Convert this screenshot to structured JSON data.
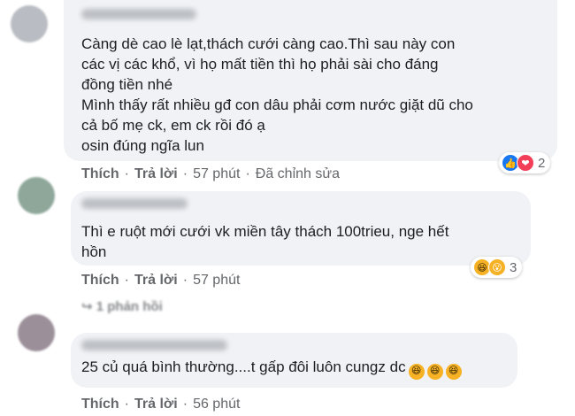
{
  "comments": [
    {
      "lines": [
        "Càng dè cao lè lạt,thách cưới càng cao.Thì sau này con",
        "các vị các khổ, vì họ mất tiền thì họ phải sài cho đáng",
        "đồng tiền nhé",
        "Mình thấy rất nhiều gđ con dâu phải cơm nước giặt dũ cho",
        "cả bố mẹ ck, em ck rồi đó ạ",
        "osin đúng ngĩa lun"
      ],
      "like": "Thích",
      "reply": "Trả lời",
      "time": "57 phút",
      "edited": "Đã chỉnh sửa",
      "reaction_icons": [
        "like-icon",
        "love-icon"
      ],
      "reaction_count": "2"
    },
    {
      "lines": [
        "Thì e ruột mới cưới vk miền tây thách 100trieu, nge hết",
        "hồn"
      ],
      "like": "Thích",
      "reply": "Trả lời",
      "time": "57 phút",
      "reaction_icons": [
        "haha-icon",
        "wow-icon"
      ],
      "reaction_count": "3",
      "replies_label": "1 phản hồi"
    },
    {
      "text": "25 củ quá bình thường....t gấp đôi luôn cungz dc",
      "inline_emoji": [
        "haha-icon",
        "haha-icon",
        "haha-icon"
      ],
      "like": "Thích",
      "reply": "Trả lời",
      "time": "56 phút"
    }
  ],
  "separator": "·"
}
